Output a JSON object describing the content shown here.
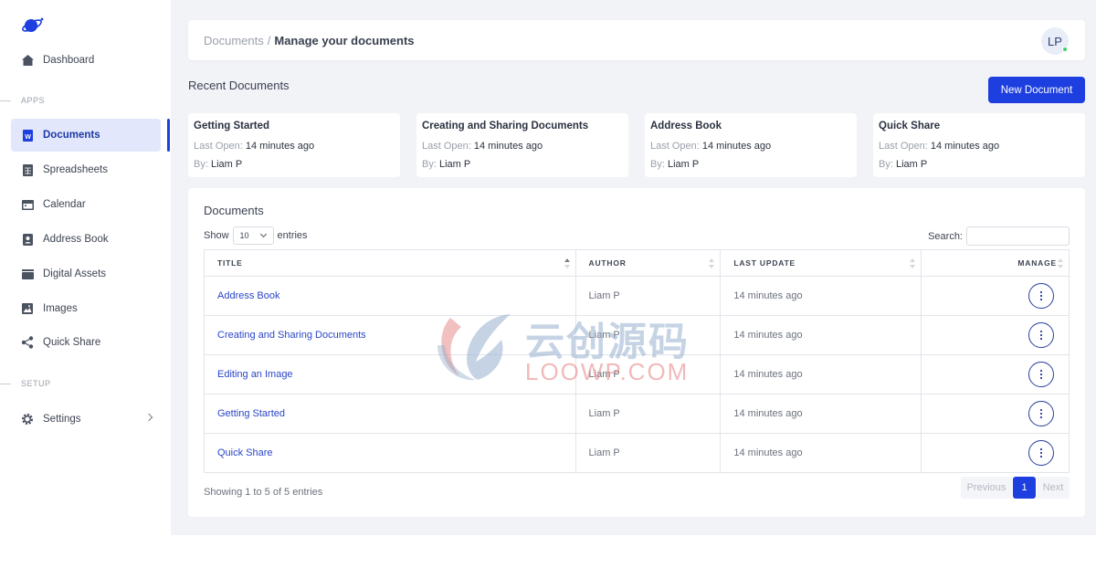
{
  "sidebar": {
    "items": [
      {
        "label": "Dashboard",
        "icon": "home-icon"
      },
      {
        "label": "Documents",
        "icon": "word-doc-icon",
        "active": true
      },
      {
        "label": "Spreadsheets",
        "icon": "spreadsheet-icon"
      },
      {
        "label": "Calendar",
        "icon": "calendar-icon"
      },
      {
        "label": "Address Book",
        "icon": "contact-book-icon"
      },
      {
        "label": "Digital Assets",
        "icon": "assets-icon"
      },
      {
        "label": "Images",
        "icon": "image-icon"
      },
      {
        "label": "Quick Share",
        "icon": "share-icon"
      },
      {
        "label": "Settings",
        "icon": "gear-icon"
      }
    ],
    "sections": {
      "apps": "APPS",
      "setup": "SETUP"
    }
  },
  "header": {
    "breadcrumb_root": "Documents",
    "breadcrumb_sep": "/",
    "breadcrumb_current": "Manage your documents",
    "avatar_initials": "LP",
    "status_color": "#3fcf6b"
  },
  "recent": {
    "title": "Recent Documents",
    "new_button": "New Document",
    "last_open_label": "Last Open:",
    "by_label": "By:",
    "cards": [
      {
        "title": "Getting Started",
        "last_open": "14 minutes ago",
        "by": "Liam P"
      },
      {
        "title": "Creating and Sharing Documents",
        "last_open": "14 minutes ago",
        "by": "Liam P"
      },
      {
        "title": "Address Book",
        "last_open": "14 minutes ago",
        "by": "Liam P"
      },
      {
        "title": "Quick Share",
        "last_open": "14 minutes ago",
        "by": "Liam P"
      }
    ]
  },
  "documents": {
    "title": "Documents",
    "show_label": "Show",
    "entries_label": "entries",
    "page_size": "10",
    "search_label": "Search:",
    "search_value": "",
    "columns": [
      "TITLE",
      "AUTHOR",
      "LAST UPDATE",
      "MANAGE"
    ],
    "rows": [
      {
        "title": "Address Book",
        "author": "Liam P",
        "updated": "14 minutes ago"
      },
      {
        "title": "Creating and Sharing Documents",
        "author": "Liam P",
        "updated": "14 minutes ago"
      },
      {
        "title": "Editing an Image",
        "author": "Liam P",
        "updated": "14 minutes ago"
      },
      {
        "title": "Getting Started",
        "author": "Liam P",
        "updated": "14 minutes ago"
      },
      {
        "title": "Quick Share",
        "author": "Liam P",
        "updated": "14 minutes ago"
      }
    ],
    "showing": "Showing 1 to 5 of 5 entries",
    "pager": {
      "prev": "Previous",
      "page": "1",
      "next": "Next"
    }
  },
  "watermark": {
    "cn": "云创源码",
    "en": "LOOWP.COM"
  },
  "colors": {
    "accent": "#1d3fe0",
    "link": "#2a46c8"
  }
}
